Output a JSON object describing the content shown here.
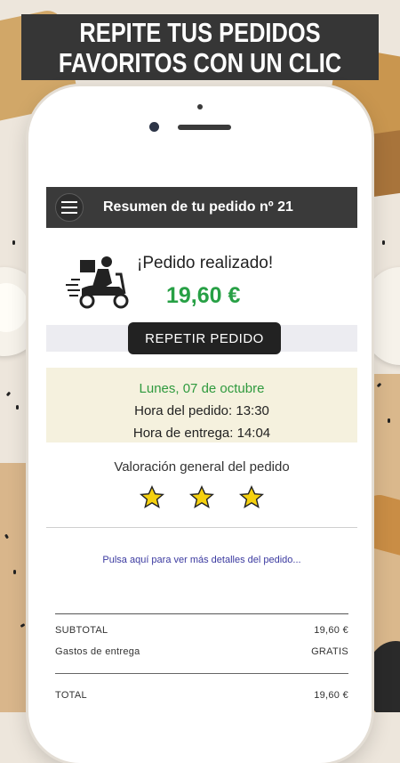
{
  "banner": {
    "line1": "REPITE TUS PEDIDOS",
    "line2": "FAVORITOS CON UN CLIC"
  },
  "app": {
    "title": "Resumen de tu pedido nº 21",
    "menu_icon": "hamburger-menu-icon"
  },
  "order": {
    "status": "¡Pedido realizado!",
    "total": "19,60 €",
    "repeat_button": "REPETIR PEDIDO",
    "delivery_icon": "delivery-scooter-icon"
  },
  "times": {
    "date": "Lunes, 07 de octubre",
    "order_time": "Hora del pedido: 13:30",
    "delivery_time": "Hora de entrega: 14:04"
  },
  "rating": {
    "title": "Valoración general del pedido",
    "stars": 3,
    "star_color": "#f5d10f"
  },
  "details_link": "Pulsa aquí para ver más detalles del pedido...",
  "summary": {
    "subtotal_label": "SUBTOTAL",
    "subtotal_value": "19,60 €",
    "shipping_label": "Gastos de entrega",
    "shipping_value": "GRATIS",
    "total_label": "TOTAL",
    "total_value": "19,60 €"
  },
  "colors": {
    "price_green": "#27a045",
    "appbar": "#3a3a3a",
    "date_green": "#2f9a3e",
    "link_blue": "#3b3aa0"
  }
}
